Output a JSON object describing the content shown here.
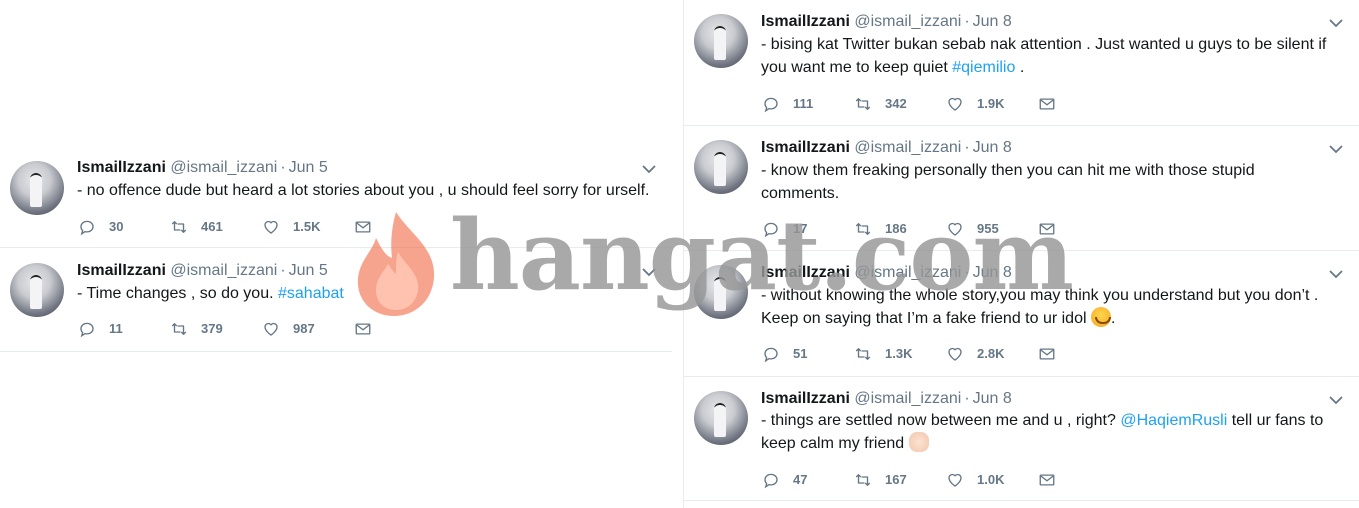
{
  "watermark": {
    "text": "hangat.com"
  },
  "icons": {
    "reply": "reply-bubble-icon",
    "retweet": "retweet-icon",
    "like": "heart-icon",
    "dm": "envelope-icon",
    "more": "chevron-down-icon"
  },
  "colors": {
    "link": "#1da1f2",
    "muted": "#657786",
    "text": "#14171a",
    "divider": "#e6ecf0"
  },
  "left_tweets": [
    {
      "name": "IsmailIzzani",
      "handle": "@ismail_izzani",
      "dot": "·",
      "date": "Jun 5",
      "text": "- no offence dude but heard a lot stories about you , u should feel sorry for urself.",
      "replies": "30",
      "retweets": "461",
      "likes": "1.5K"
    },
    {
      "name": "IsmailIzzani",
      "handle": "@ismail_izzani",
      "dot": "·",
      "date": "Jun 5",
      "text_pre": "- Time changes , so do you. ",
      "hashtag": "#sahabat",
      "replies": "11",
      "retweets": "379",
      "likes": "987"
    }
  ],
  "right_tweets": [
    {
      "name": "IsmailIzzani",
      "handle": "@ismail_izzani",
      "dot": "·",
      "date": "Jun 8",
      "line1": "- bising kat Twitter bukan sebab nak attention . Just wanted u guys to be silent if",
      "line2_pre": "you want me to keep quiet ",
      "hashtag": "#qiemilio",
      "line2_post": " .",
      "replies": "111",
      "retweets": "342",
      "likes": "1.9K"
    },
    {
      "name": "IsmailIzzani",
      "handle": "@ismail_izzani",
      "dot": "·",
      "date": "Jun 8",
      "line1": "- know them freaking personally then you can hit me with those stupid",
      "line2": "comments.",
      "replies": "17",
      "retweets": "186",
      "likes": "955"
    },
    {
      "name": "IsmailIzzani",
      "handle": "@ismail_izzani",
      "dot": "·",
      "date": "Jun 8",
      "line1": "- without knowing the whole story,you may think you understand but you don’t .",
      "line2_pre": "Keep on saying that I’m a fake friend to ur idol ",
      "line2_post": ".",
      "emoji": "smiling-face-emoji",
      "replies": "51",
      "retweets": "1.3K",
      "likes": "2.8K"
    },
    {
      "name": "IsmailIzzani",
      "handle": "@ismail_izzani",
      "dot": "·",
      "date": "Jun 8",
      "line1_pre": "- things are settled now between me and u , right? ",
      "mention": "@HaqiemRusli",
      "line1_post": " tell ur fans to",
      "line2_pre": "keep calm my friend ",
      "emoji": "ok-hand-emoji",
      "replies": "47",
      "retweets": "167",
      "likes": "1.0K"
    }
  ]
}
